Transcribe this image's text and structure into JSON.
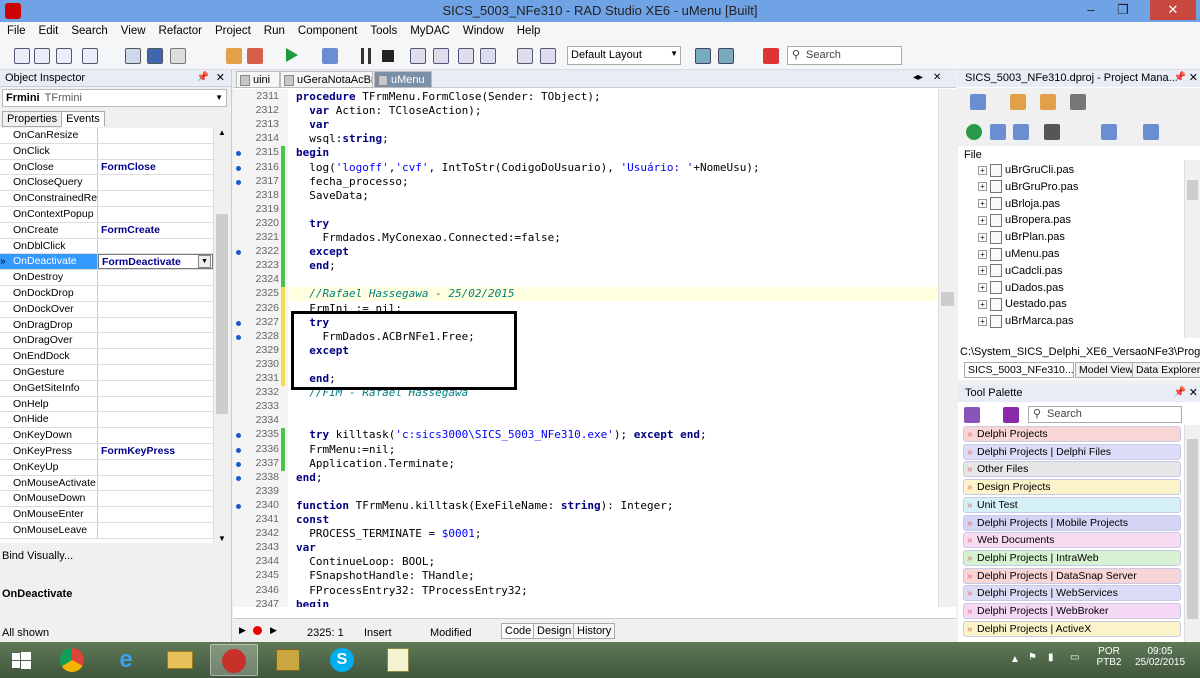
{
  "window": {
    "title": "SICS_5003_NFe310 - RAD Studio XE6 - uMenu [Built]"
  },
  "menu": [
    "File",
    "Edit",
    "Search",
    "View",
    "Refactor",
    "Project",
    "Run",
    "Component",
    "Tools",
    "MyDAC",
    "Window",
    "Help"
  ],
  "toolbar": {
    "layout": "Default Layout",
    "search_placeholder": "Search"
  },
  "object_inspector": {
    "title": "Object Inspector",
    "object_name": "Frmini",
    "object_type": "TFrmini",
    "tabs": [
      "Properties",
      "Events"
    ],
    "events": [
      {
        "name": "OnCanResize",
        "value": ""
      },
      {
        "name": "OnClick",
        "value": ""
      },
      {
        "name": "OnClose",
        "value": "FormClose"
      },
      {
        "name": "OnCloseQuery",
        "value": ""
      },
      {
        "name": "OnConstrainedRes",
        "value": ""
      },
      {
        "name": "OnContextPopup",
        "value": ""
      },
      {
        "name": "OnCreate",
        "value": "FormCreate"
      },
      {
        "name": "OnDblClick",
        "value": ""
      },
      {
        "name": "OnDeactivate",
        "value": "FormDeactivate"
      },
      {
        "name": "OnDestroy",
        "value": ""
      },
      {
        "name": "OnDockDrop",
        "value": ""
      },
      {
        "name": "OnDockOver",
        "value": ""
      },
      {
        "name": "OnDragDrop",
        "value": ""
      },
      {
        "name": "OnDragOver",
        "value": ""
      },
      {
        "name": "OnEndDock",
        "value": ""
      },
      {
        "name": "OnGesture",
        "value": ""
      },
      {
        "name": "OnGetSiteInfo",
        "value": ""
      },
      {
        "name": "OnHelp",
        "value": ""
      },
      {
        "name": "OnHide",
        "value": ""
      },
      {
        "name": "OnKeyDown",
        "value": ""
      },
      {
        "name": "OnKeyPress",
        "value": "FormKeyPress"
      },
      {
        "name": "OnKeyUp",
        "value": ""
      },
      {
        "name": "OnMouseActivate",
        "value": ""
      },
      {
        "name": "OnMouseDown",
        "value": ""
      },
      {
        "name": "OnMouseEnter",
        "value": ""
      },
      {
        "name": "OnMouseLeave",
        "value": ""
      }
    ],
    "bind_visually": "Bind Visually...",
    "selected_event": "OnDeactivate",
    "filter": "All shown"
  },
  "editor": {
    "tabs": [
      "uini",
      "uGeraNotaAcBr",
      "uMenu"
    ],
    "lines": [
      {
        "n": "2311",
        "text": "procedure TFrmMenu.FormClose(Sender: TObject);"
      },
      {
        "n": "2312",
        "text": "  var Action: TCloseAction);"
      },
      {
        "n": "2313",
        "text": "  var"
      },
      {
        "n": "2314",
        "text": "  wsql:string;"
      },
      {
        "n": "2315",
        "text": "begin"
      },
      {
        "n": "2316",
        "text": "  log('logoff','cvf', IntToStr(CodigoDoUsuario), 'Usuário: '+NomeUsu);"
      },
      {
        "n": "2317",
        "text": "  fecha_processo;"
      },
      {
        "n": "2318",
        "text": "  SaveData;"
      },
      {
        "n": "2319",
        "text": ""
      },
      {
        "n": "2320",
        "text": "  try"
      },
      {
        "n": "2321",
        "text": "    Frmdados.MyConexao.Connected:=false;"
      },
      {
        "n": "2322",
        "text": "  except"
      },
      {
        "n": "2323",
        "text": "  end;"
      },
      {
        "n": "2324",
        "text": ""
      },
      {
        "n": "2325",
        "text": "  //Rafael Hassegawa - 25/02/2015"
      },
      {
        "n": "2326",
        "text": "  FrmIni := nil;"
      },
      {
        "n": "2327",
        "text": "  try"
      },
      {
        "n": "2328",
        "text": "    FrmDados.ACBrNFe1.Free;"
      },
      {
        "n": "2329",
        "text": "  except"
      },
      {
        "n": "2330",
        "text": ""
      },
      {
        "n": "2331",
        "text": "  end;"
      },
      {
        "n": "2332",
        "text": "  //FIM - Rafael Hassegawa"
      },
      {
        "n": "2333",
        "text": ""
      },
      {
        "n": "2334",
        "text": ""
      },
      {
        "n": "2335",
        "text": "  try killtask('c:sics3000\\SICS_5003_NFe310.exe'); except end;"
      },
      {
        "n": "2336",
        "text": "  FrmMenu:=nil;"
      },
      {
        "n": "2337",
        "text": "  Application.Terminate;"
      },
      {
        "n": "2338",
        "text": "end;"
      },
      {
        "n": "2339",
        "text": ""
      },
      {
        "n": "2340",
        "text": "function TFrmMenu.killtask(ExeFileName: string): Integer;"
      },
      {
        "n": "2341",
        "text": "const"
      },
      {
        "n": "2342",
        "text": "  PROCESS_TERMINATE = $0001;"
      },
      {
        "n": "2343",
        "text": "var"
      },
      {
        "n": "2344",
        "text": "  ContinueLoop: BOOL;"
      },
      {
        "n": "2345",
        "text": "  FSnapshotHandle: THandle;"
      },
      {
        "n": "2346",
        "text": "  FProcessEntry32: TProcessEntry32;"
      },
      {
        "n": "2347",
        "text": "begin"
      }
    ],
    "status": {
      "position": "2325:  1",
      "mode": "Insert",
      "state": "Modified",
      "tabs": [
        "Code",
        "Design",
        "History"
      ]
    }
  },
  "project_manager": {
    "title": "SICS_5003_NFe310.dproj - Project Mana...",
    "file_label": "File",
    "files": [
      "uBrGruCli.pas",
      "uBrGruPro.pas",
      "uBrloja.pas",
      "uBropera.pas",
      "uBrPlan.pas",
      "uMenu.pas",
      "uCadcli.pas",
      "uDados.pas",
      "Uestado.pas",
      "uBrMarca.pas"
    ],
    "path": "C:\\System_SICS_Delphi_XE6_VersaoNFe3\\Programa",
    "tabs": [
      "SICS_5003_NFe310....",
      "Model View",
      "Data Explorer"
    ]
  },
  "tool_palette": {
    "title": "Tool Palette",
    "search_placeholder": "Search",
    "categories": [
      {
        "label": "Delphi Projects",
        "color": "#f9d6d6"
      },
      {
        "label": "Delphi Projects | Delphi Files",
        "color": "#dcdcf6"
      },
      {
        "label": "Other Files",
        "color": "#e6e6e6"
      },
      {
        "label": "Design Projects",
        "color": "#fbf3c9"
      },
      {
        "label": "Unit Test",
        "color": "#d6f1f6"
      },
      {
        "label": "Delphi Projects | Mobile Projects",
        "color": "#d4d4f4"
      },
      {
        "label": "Web Documents",
        "color": "#f8dcf1"
      },
      {
        "label": "Delphi Projects | IntraWeb",
        "color": "#d7f2d2"
      },
      {
        "label": "Delphi Projects | DataSnap Server",
        "color": "#f9d6d6"
      },
      {
        "label": "Delphi Projects | WebServices",
        "color": "#dcdcf6"
      },
      {
        "label": "Delphi Projects | WebBroker",
        "color": "#f4d8f4"
      },
      {
        "label": "Delphi Projects | ActiveX",
        "color": "#fbf3c9"
      }
    ]
  },
  "taskbar": {
    "lang": "POR",
    "kb": "PTB2",
    "time": "09:05",
    "date": "25/02/2015"
  }
}
